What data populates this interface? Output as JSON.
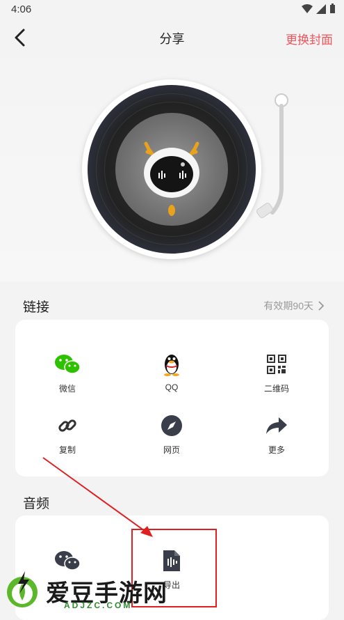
{
  "status": {
    "time": "4:06"
  },
  "nav": {
    "title": "分享",
    "action": "更换封面"
  },
  "link_section": {
    "title": "链接",
    "validity": "有效期90天",
    "items": [
      {
        "label": "微信",
        "icon": "wechat-icon"
      },
      {
        "label": "QQ",
        "icon": "qq-penguin-icon"
      },
      {
        "label": "二维码",
        "icon": "qr-code-icon"
      },
      {
        "label": "复制",
        "icon": "link-icon"
      },
      {
        "label": "网页",
        "icon": "compass-icon"
      },
      {
        "label": "更多",
        "icon": "share-arrow-icon"
      }
    ]
  },
  "audio_section": {
    "title": "音频",
    "items": [
      {
        "label": "",
        "icon": "wechat-icon"
      },
      {
        "label": "导出",
        "icon": "audio-file-icon"
      }
    ]
  },
  "watermark": {
    "text": "爱豆手游网",
    "sub": "ADJZC.COM"
  },
  "colors": {
    "accent": "#f2545b",
    "wechat": "#2dc100",
    "highlight": "#e02020"
  }
}
